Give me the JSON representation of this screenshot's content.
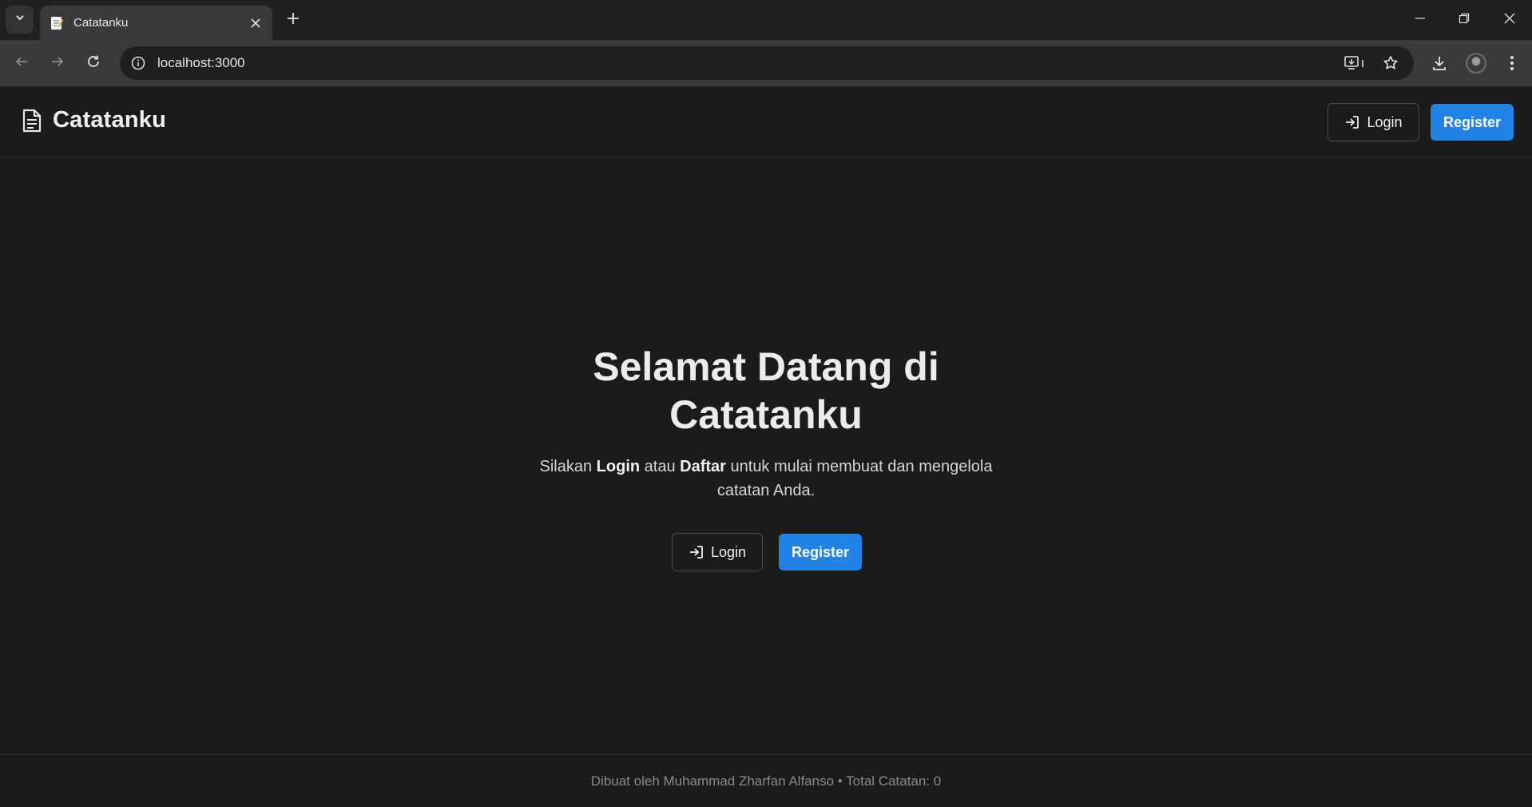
{
  "browser": {
    "tab_title": "Catatanku",
    "url": "localhost:3000"
  },
  "navbar": {
    "brand": "Catatanku",
    "login_label": "Login",
    "register_label": "Register"
  },
  "hero": {
    "title_line1": "Selamat Datang di",
    "title_line2": "Catatanku",
    "sub_pre": "Silakan ",
    "sub_login": "Login",
    "sub_mid": " atau ",
    "sub_daftar": "Daftar",
    "sub_post": " untuk mulai membuat dan mengelola catatan Anda.",
    "login_label": "Login",
    "register_label": "Register"
  },
  "footer": {
    "text": "Dibuat oleh Muhammad Zharfan Alfanso • Total Catatan: 0"
  },
  "colors": {
    "accent": "#2382e6",
    "page_bg": "#1b1b1b"
  },
  "icons": [
    "chevron-down-icon",
    "memo-icon",
    "close-icon",
    "plus-icon",
    "minimize-icon",
    "restore-icon",
    "back-icon",
    "forward-icon",
    "reload-icon",
    "info-icon",
    "install-app-icon",
    "star-icon",
    "download-icon",
    "menu-dots-icon",
    "document-icon",
    "login-icon"
  ]
}
